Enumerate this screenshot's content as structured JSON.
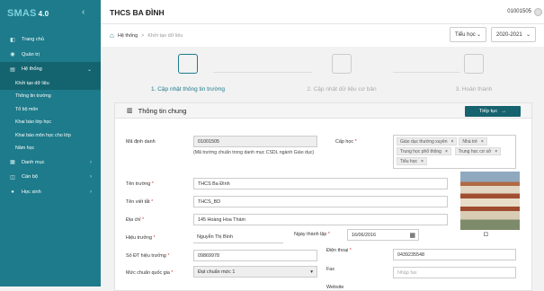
{
  "app": {
    "logo_main": "SMAS",
    "logo_version": "4.0"
  },
  "sidebar": {
    "items": [
      {
        "label": "Trang chủ",
        "icon": "dashboard-icon"
      },
      {
        "label": "Quản trị",
        "icon": "admin-icon"
      },
      {
        "label": "Hệ thống",
        "icon": "system-icon"
      }
    ],
    "subitems": [
      {
        "label": "Khởi tạo dữ liệu"
      },
      {
        "label": "Thông tin trường"
      },
      {
        "label": "Tổ bộ môn"
      },
      {
        "label": "Khai báo lớp học"
      },
      {
        "label": "Khai báo môn học cho lớp"
      },
      {
        "label": "Năm học"
      }
    ],
    "bottom": [
      {
        "label": "Danh mục",
        "icon": "grid-icon"
      },
      {
        "label": "Cán bộ",
        "icon": "staff-icon"
      },
      {
        "label": "Học sinh",
        "icon": "student-icon"
      }
    ]
  },
  "header": {
    "school": "THCS BA ĐÌNH",
    "user_id": "01001505"
  },
  "breadcrumb": {
    "first": "Hệ thống",
    "sep": ">",
    "current": "Khởi tạo dữ liệu"
  },
  "filters": {
    "level": "Tiểu học",
    "year": "2020-2021"
  },
  "steps": [
    {
      "label": "1. Cập nhật thông tin trường"
    },
    {
      "label": "2. Cập nhật dữ liệu cơ bản"
    },
    {
      "label": "3. Hoàn thành"
    }
  ],
  "panel": {
    "title": "Thông tin chung",
    "next_button": "Tiếp tục",
    "fields": {
      "code_label": "Mã định danh",
      "code_value": "01001505",
      "code_note": "(Mã trường chuẩn trong danh mục CSDL ngành Giáo dục)",
      "level_label": "Cấp học",
      "level_tags": [
        "Giáo dục thường xuyên",
        "Nhà trẻ",
        "Trung học phổ thông",
        "Trung học cơ sở",
        "Tiểu học"
      ],
      "name_label": "Tên trường",
      "name_value": "THCS Ba Đình",
      "short_label": "Tên viết tắt",
      "short_value": "THCS_BD",
      "address_label": "Địa chỉ",
      "address_value": "145 Hoàng Hoa Thám",
      "principal_label": "Hiệu trưởng",
      "principal_value": "Nguyễn Thị Bình",
      "founded_label": "Ngày thành lập",
      "founded_value": "16/06/2016",
      "principal_phone_label": "Số ĐT hiệu trưởng",
      "principal_phone_value": "09869978",
      "phone_label": "Điện thoại",
      "phone_value": "0439235548",
      "standard_label": "Mức chuẩn quốc gia",
      "standard_value": "Đạt chuẩn mức 1",
      "fax_label": "Fax",
      "fax_placeholder": "Nhập fax",
      "website_label": "Website"
    }
  },
  "colors": {
    "sidebar": "#1d7b8b",
    "accent": "#17626f"
  }
}
